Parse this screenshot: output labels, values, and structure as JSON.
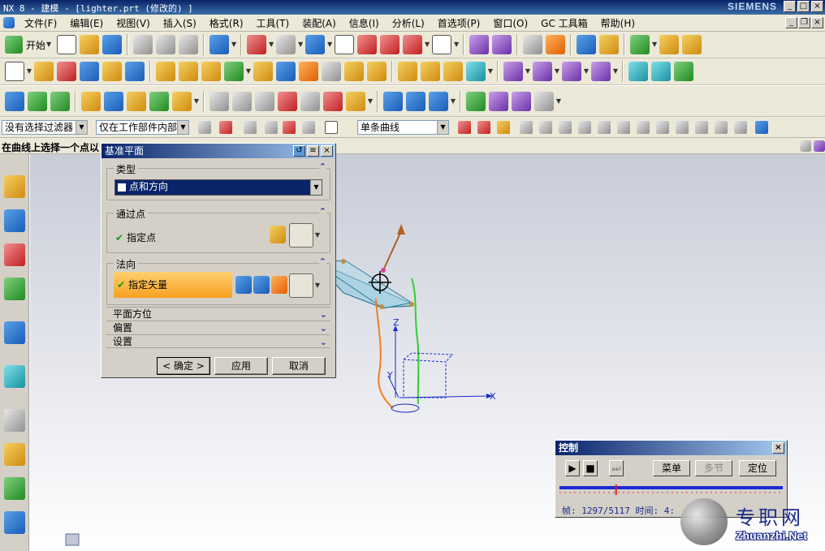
{
  "window": {
    "title": "NX 8 - 建模 - [lighter.prt (修改的) ]",
    "brand": "SIEMENS"
  },
  "menu": [
    "文件(F)",
    "编辑(E)",
    "视图(V)",
    "插入(S)",
    "格式(R)",
    "工具(T)",
    "装配(A)",
    "信息(I)",
    "分析(L)",
    "首选项(P)",
    "窗口(O)",
    "GC 工具箱",
    "帮助(H)"
  ],
  "toolbar": {
    "start_label": "开始"
  },
  "filterbar": {
    "selection_filter": "没有选择过滤器",
    "scope": "仅在工作部件内部",
    "curve_rule": "单条曲线"
  },
  "status": {
    "prompt": "在曲线上选择一个点以"
  },
  "dialog": {
    "title": "基准平面",
    "type_group": "类型",
    "type_value": "点和方向",
    "point_group": "通过点",
    "point_label": "指定点",
    "normal_group": "法向",
    "vector_label": "指定矢量",
    "plane_orient": "平面方位",
    "offset": "偏置",
    "settings": "设置",
    "ok": "< 确定 >",
    "apply": "应用",
    "cancel": "取消"
  },
  "viewport": {
    "axis_x": "X",
    "axis_y": "Y",
    "axis_z": "Z"
  },
  "control": {
    "title": "控制",
    "menu_btn": "菜单",
    "multi_btn": "多节",
    "locate_btn": "定位",
    "frames_text": "帧: 1297/5117 时间: 4:"
  },
  "watermark": {
    "cn": "专职网",
    "en": "Zhuanzhi.Net"
  }
}
